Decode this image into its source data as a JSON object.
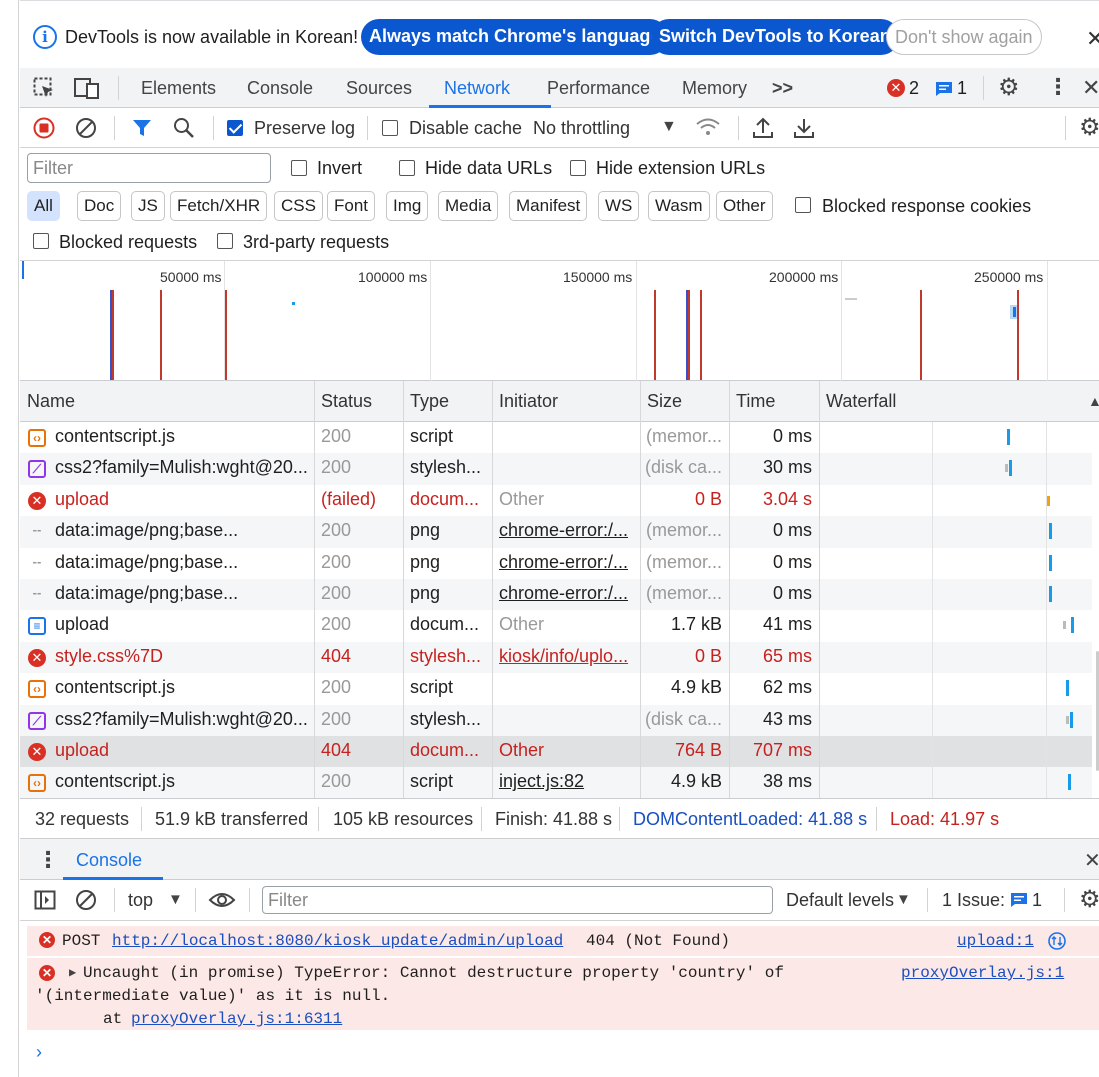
{
  "infobar": {
    "message": "DevTools is now available in Korean!",
    "btn_always": "Always match Chrome's language",
    "btn_switch": "Switch DevTools to Korean",
    "btn_dont_show": "Don't show again"
  },
  "tabs": {
    "elements": "Elements",
    "console": "Console",
    "sources": "Sources",
    "network": "Network",
    "performance": "Performance",
    "memory": "Memory",
    "more": ">>",
    "error_count": "2",
    "message_count": "1"
  },
  "net_toolbar": {
    "preserve_log": "Preserve log",
    "disable_cache": "Disable cache",
    "throttling": "No throttling"
  },
  "filters": {
    "placeholder": "Filter",
    "invert": "Invert",
    "hide_data": "Hide data URLs",
    "hide_ext": "Hide extension URLs",
    "types": [
      "All",
      "Doc",
      "JS",
      "Fetch/XHR",
      "CSS",
      "Font",
      "Img",
      "Media",
      "Manifest",
      "WS",
      "Wasm",
      "Other"
    ],
    "blocked_cookies": "Blocked response cookies",
    "blocked_requests": "Blocked requests",
    "third_party": "3rd-party requests"
  },
  "overview": {
    "ticks": [
      "50000 ms",
      "100000 ms",
      "150000 ms",
      "200000 ms",
      "250000 ms"
    ]
  },
  "table": {
    "headers": {
      "name": "Name",
      "status": "Status",
      "type": "Type",
      "initiator": "Initiator",
      "size": "Size",
      "time": "Time",
      "waterfall": "Waterfall"
    },
    "rows": [
      {
        "name": "contentscript.js",
        "status": "200",
        "type": "script",
        "initiator": "",
        "size": "(memor...",
        "time": "0 ms"
      },
      {
        "name": "css2?family=Mulish:wght@20...",
        "status": "200",
        "type": "stylesh...",
        "initiator": "",
        "size": "(disk ca...",
        "time": "30 ms"
      },
      {
        "name": "upload",
        "status": "(failed)",
        "type": "docum...",
        "initiator": "Other",
        "size": "0 B",
        "time": "3.04 s"
      },
      {
        "name": "data:image/png;base...",
        "status": "200",
        "type": "png",
        "initiator": "chrome-error:/...",
        "size": "(memor...",
        "time": "0 ms"
      },
      {
        "name": "data:image/png;base...",
        "status": "200",
        "type": "png",
        "initiator": "chrome-error:/...",
        "size": "(memor...",
        "time": "0 ms"
      },
      {
        "name": "data:image/png;base...",
        "status": "200",
        "type": "png",
        "initiator": "chrome-error:/...",
        "size": "(memor...",
        "time": "0 ms"
      },
      {
        "name": "upload",
        "status": "200",
        "type": "docum...",
        "initiator": "Other",
        "size": "1.7 kB",
        "time": "41 ms"
      },
      {
        "name": "style.css%7D",
        "status": "404",
        "type": "stylesh...",
        "initiator": "kiosk/info/uplo...",
        "size": "0 B",
        "time": "65 ms"
      },
      {
        "name": "contentscript.js",
        "status": "200",
        "type": "script",
        "initiator": "",
        "size": "4.9 kB",
        "time": "62 ms"
      },
      {
        "name": "css2?family=Mulish:wght@20...",
        "status": "200",
        "type": "stylesh...",
        "initiator": "",
        "size": "(disk ca...",
        "time": "43 ms"
      },
      {
        "name": "upload",
        "status": "404",
        "type": "docum...",
        "initiator": "Other",
        "size": "764 B",
        "time": "707 ms"
      },
      {
        "name": "contentscript.js",
        "status": "200",
        "type": "script",
        "initiator": "inject.js:82",
        "size": "4.9 kB",
        "time": "38 ms"
      }
    ]
  },
  "statusbar": {
    "requests": "32 requests",
    "transferred": "51.9 kB transferred",
    "resources": "105 kB resources",
    "finish": "Finish: 41.88 s",
    "dcl": "DOMContentLoaded: 41.88 s",
    "load": "Load: 41.97 s"
  },
  "drawer": {
    "tab": "Console"
  },
  "console_toolbar": {
    "context": "top",
    "filter_placeholder": "Filter",
    "levels": "Default levels",
    "issues_label": "1 Issue:",
    "issues_count": "1"
  },
  "console": {
    "msg1_method": "POST",
    "msg1_url": "http://localhost:8080/kiosk_update/admin/upload",
    "msg1_status": "404 (Not Found)",
    "msg1_source": "upload:1",
    "msg2_line1": "Uncaught (in promise) TypeError: Cannot destructure property 'country' of",
    "msg2_line2": "'(intermediate value)' as it is null.",
    "msg2_at": "at",
    "msg2_at_link": "proxyOverlay.js:1:6311",
    "msg2_source": "proxyOverlay.js:1"
  }
}
